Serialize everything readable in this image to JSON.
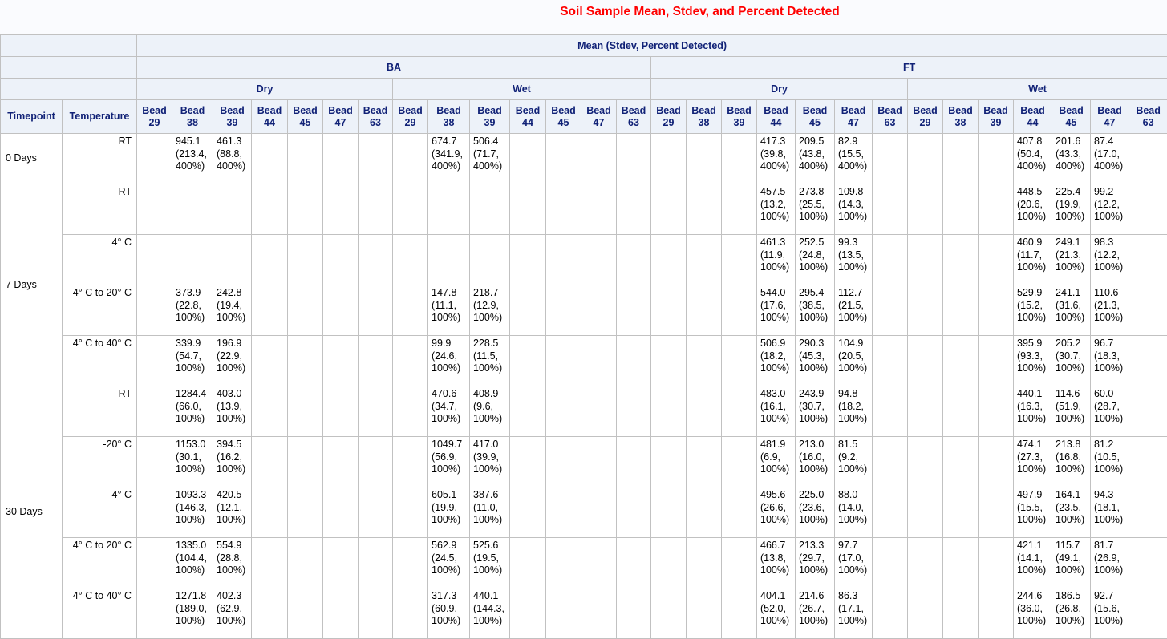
{
  "title": "Soil Sample Mean, Stdev, and Percent Detected",
  "header": {
    "stat_label": "Mean (Stdev, Percent Detected)",
    "timepoint_label": "Timepoint",
    "temperature_label": "Temperature",
    "groups": [
      {
        "label": "BA",
        "conditions": [
          {
            "label": "Dry"
          },
          {
            "label": "Wet"
          }
        ]
      },
      {
        "label": "FT",
        "conditions": [
          {
            "label": "Dry"
          },
          {
            "label": "Wet"
          }
        ]
      }
    ],
    "beads": [
      "Bead 29",
      "Bead 38",
      "Bead 39",
      "Bead 44",
      "Bead 45",
      "Bead 47",
      "Bead 63"
    ]
  },
  "timepoints": [
    {
      "label": "0 Days",
      "rows": [
        {
          "temperature": "RT",
          "values": [
            "",
            "945.1 (213.4, 400%)",
            "461.3 (88.8, 400%)",
            "",
            "",
            "",
            "",
            "",
            "674.7 (341.9, 400%)",
            "506.4 (71.7, 400%)",
            "",
            "",
            "",
            "",
            "",
            "",
            "",
            "417.3 (39.8, 400%)",
            "209.5 (43.8, 400%)",
            "82.9 (15.5, 400%)",
            "",
            "",
            "",
            "",
            "407.8 (50.4, 400%)",
            "201.6 (43.3, 400%)",
            "87.4 (17.0, 400%)",
            ""
          ]
        }
      ]
    },
    {
      "label": "7 Days",
      "rows": [
        {
          "temperature": "RT",
          "values": [
            "",
            "",
            "",
            "",
            "",
            "",
            "",
            "",
            "",
            "",
            "",
            "",
            "",
            "",
            "",
            "",
            "",
            "457.5 (13.2, 100%)",
            "273.8 (25.5, 100%)",
            "109.8 (14.3, 100%)",
            "",
            "",
            "",
            "",
            "448.5 (20.6, 100%)",
            "225.4 (19.9, 100%)",
            "99.2 (12.2, 100%)",
            ""
          ]
        },
        {
          "temperature": "4° C",
          "values": [
            "",
            "",
            "",
            "",
            "",
            "",
            "",
            "",
            "",
            "",
            "",
            "",
            "",
            "",
            "",
            "",
            "",
            "461.3 (11.9, 100%)",
            "252.5 (24.8, 100%)",
            "99.3 (13.5, 100%)",
            "",
            "",
            "",
            "",
            "460.9 (11.7, 100%)",
            "249.1 (21.3, 100%)",
            "98.3 (12.2, 100%)",
            ""
          ]
        },
        {
          "temperature": "4° C to 20° C",
          "values": [
            "",
            "373.9 (22.8, 100%)",
            "242.8 (19.4, 100%)",
            "",
            "",
            "",
            "",
            "",
            "147.8 (11.1, 100%)",
            "218.7 (12.9, 100%)",
            "",
            "",
            "",
            "",
            "",
            "",
            "",
            "544.0 (17.6, 100%)",
            "295.4 (38.5, 100%)",
            "112.7 (21.5, 100%)",
            "",
            "",
            "",
            "",
            "529.9 (15.2, 100%)",
            "241.1 (31.6, 100%)",
            "110.6 (21.3, 100%)",
            ""
          ]
        },
        {
          "temperature": "4° C to 40° C",
          "values": [
            "",
            "339.9 (54.7, 100%)",
            "196.9 (22.9, 100%)",
            "",
            "",
            "",
            "",
            "",
            "99.9 (24.6, 100%)",
            "228.5 (11.5, 100%)",
            "",
            "",
            "",
            "",
            "",
            "",
            "",
            "506.9 (18.2, 100%)",
            "290.3 (45.3, 100%)",
            "104.9 (20.5, 100%)",
            "",
            "",
            "",
            "",
            "395.9 (93.3, 100%)",
            "205.2 (30.7, 100%)",
            "96.7 (18.3, 100%)",
            ""
          ]
        }
      ]
    },
    {
      "label": "30 Days",
      "rows": [
        {
          "temperature": "RT",
          "values": [
            "",
            "1284.4 (66.0, 100%)",
            "403.0 (13.9, 100%)",
            "",
            "",
            "",
            "",
            "",
            "470.6 (34.7, 100%)",
            "408.9 (9.6, 100%)",
            "",
            "",
            "",
            "",
            "",
            "",
            "",
            "483.0 (16.1, 100%)",
            "243.9 (30.7, 100%)",
            "94.8 (18.2, 100%)",
            "",
            "",
            "",
            "",
            "440.1 (16.3, 100%)",
            "114.6 (51.9, 100%)",
            "60.0 (28.7, 100%)",
            ""
          ]
        },
        {
          "temperature": "-20° C",
          "values": [
            "",
            "1153.0 (30.1, 100%)",
            "394.5 (16.2, 100%)",
            "",
            "",
            "",
            "",
            "",
            "1049.7 (56.9, 100%)",
            "417.0 (39.9, 100%)",
            "",
            "",
            "",
            "",
            "",
            "",
            "",
            "481.9 (6.9, 100%)",
            "213.0 (16.0, 100%)",
            "81.5 (9.2, 100%)",
            "",
            "",
            "",
            "",
            "474.1 (27.3, 100%)",
            "213.8 (16.8, 100%)",
            "81.2 (10.5, 100%)",
            ""
          ]
        },
        {
          "temperature": "4° C",
          "values": [
            "",
            "1093.3 (146.3, 100%)",
            "420.5 (12.1, 100%)",
            "",
            "",
            "",
            "",
            "",
            "605.1 (19.9, 100%)",
            "387.6 (11.0, 100%)",
            "",
            "",
            "",
            "",
            "",
            "",
            "",
            "495.6 (26.6, 100%)",
            "225.0 (23.6, 100%)",
            "88.0 (14.0, 100%)",
            "",
            "",
            "",
            "",
            "497.9 (15.5, 100%)",
            "164.1 (23.5, 100%)",
            "94.3 (18.1, 100%)",
            ""
          ]
        },
        {
          "temperature": "4° C to 20° C",
          "values": [
            "",
            "1335.0 (104.4, 100%)",
            "554.9 (28.8, 100%)",
            "",
            "",
            "",
            "",
            "",
            "562.9 (24.5, 100%)",
            "525.6 (19.5, 100%)",
            "",
            "",
            "",
            "",
            "",
            "",
            "",
            "466.7 (13.8, 100%)",
            "213.3 (29.7, 100%)",
            "97.7 (17.0, 100%)",
            "",
            "",
            "",
            "",
            "421.1 (14.1, 100%)",
            "115.7 (49.1, 100%)",
            "81.7 (26.9, 100%)",
            ""
          ]
        },
        {
          "temperature": "4° C to 40° C",
          "values": [
            "",
            "1271.8 (189.0, 100%)",
            "402.3 (62.9, 100%)",
            "",
            "",
            "",
            "",
            "",
            "317.3 (60.9, 100%)",
            "440.1 (144.3, 100%)",
            "",
            "",
            "",
            "",
            "",
            "",
            "",
            "404.1 (52.0, 100%)",
            "214.6 (26.7, 100%)",
            "86.3 (17.1, 100%)",
            "",
            "",
            "",
            "",
            "244.6 (36.0, 100%)",
            "186.5 (26.8, 100%)",
            "92.7 (15.6, 100%)",
            ""
          ]
        }
      ]
    }
  ]
}
